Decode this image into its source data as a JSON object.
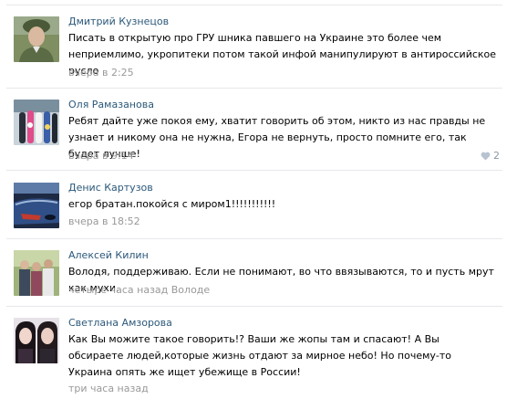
{
  "comments": [
    {
      "author": "Дмитрий Кузнецов",
      "text": "Писать в открытую про ГРУ шника павшего на Украине это более чем неприемлимо, укропитеки потом такой инфой манипулируют в антироссийское русло",
      "time": "вчера в 2:25",
      "avatar": "avatar-photo-soldier"
    },
    {
      "author": "Оля Рамазанова",
      "text": "Ребят дайте уже покоя ему, хватит говорить об этом, никто из нас правды не узнает и никому она не нужна, Егора не вернуть, просто помните его, так будет лучше!",
      "time": "вчера в 9:14",
      "likes": "2",
      "like_icon": "heart-icon",
      "avatar": "avatar-photo-snowboards"
    },
    {
      "author": "Денис Картузов",
      "text": "егор братан.покойся с миром1!!!!!!!!!!!",
      "time": "вчера в 18:52",
      "avatar": "avatar-photo-car"
    },
    {
      "author": "Алексей Килин",
      "text": "Володя, поддерживаю. Если не понимают, во что ввязываются, то и пусть мрут как мухи.",
      "time": "четыре часа назад",
      "reply_to": "Володе",
      "avatar": "avatar-photo-group"
    },
    {
      "author": "Светлана Амзорова",
      "text": "Как Вы можите такое говорить!? Ваши же жопы там и спасают! А Вы обсираете людей,которые жизнь отдают за мирное небо! Но почему-то Украина опять же ищет убежище в России!",
      "time": "три часа назад",
      "avatar": "avatar-photo-two-girls"
    }
  ],
  "colors": {
    "author": "#2b587a",
    "meta": "#999999",
    "divider": "#e7e8ec",
    "like": "#8a97a5"
  }
}
